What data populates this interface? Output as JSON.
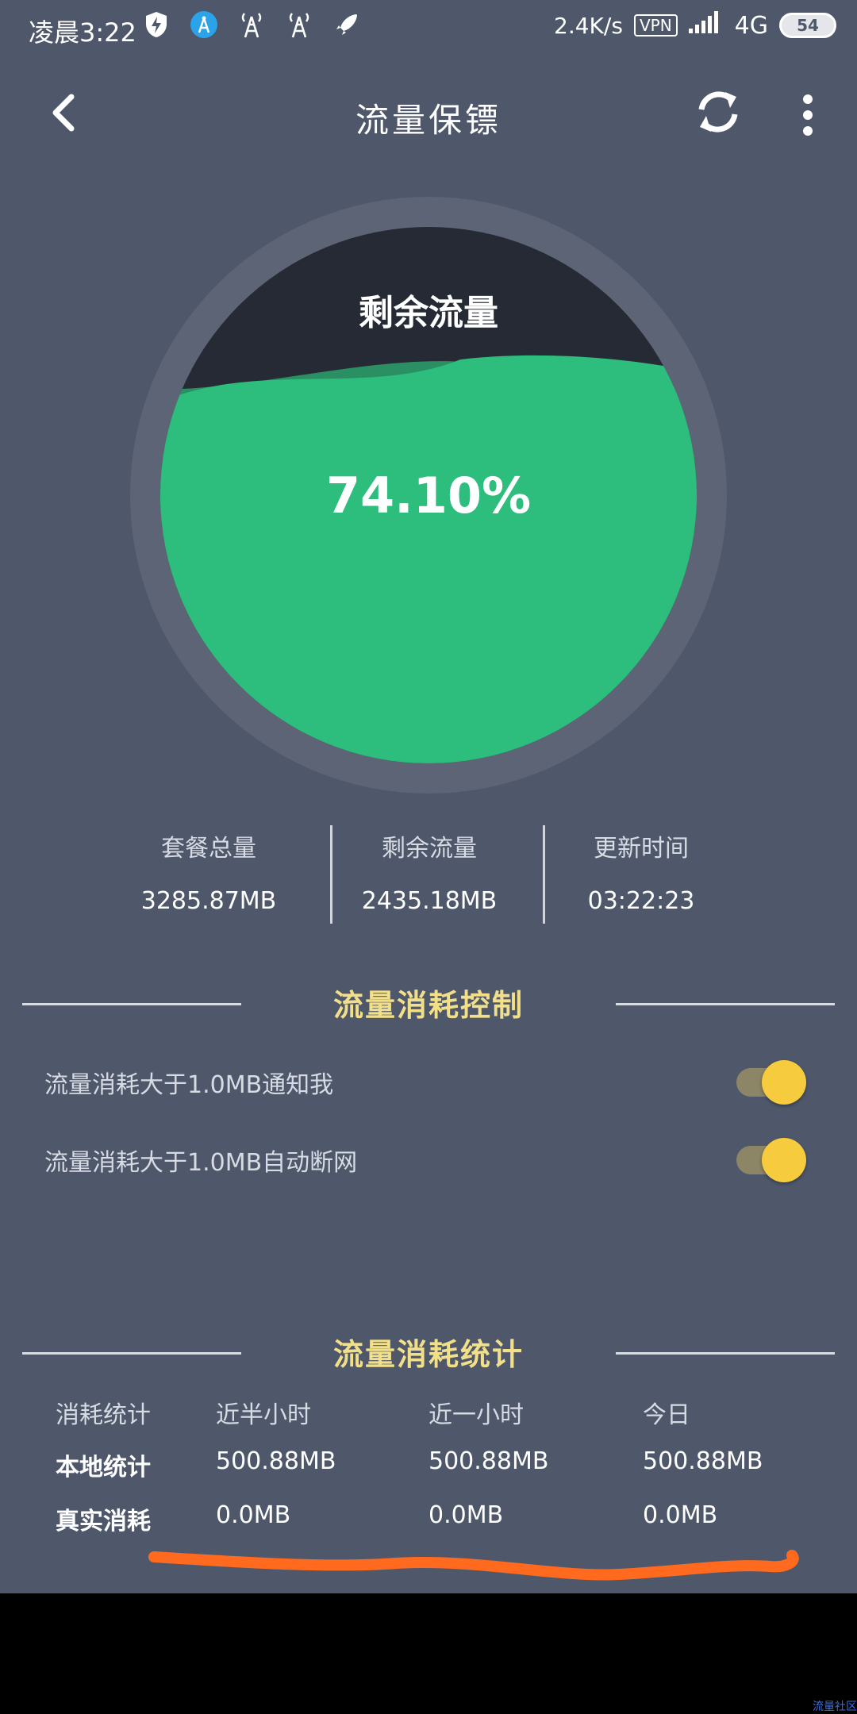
{
  "status_bar": {
    "time": "凌晨3:22",
    "speed": "2.4K/s",
    "vpn": "VPN",
    "network": "4G",
    "battery": "54",
    "icons": [
      "shield-bolt-icon",
      "signal-tower-blue-icon",
      "signal-tower-icon",
      "signal-tower-icon",
      "rocket-icon"
    ]
  },
  "toolbar": {
    "title": "流量保镖",
    "back_icon": "chevron-left-icon",
    "refresh_icon": "refresh-icon",
    "more_icon": "more-vertical-icon"
  },
  "gauge": {
    "label": "剩余流量",
    "percent_text": "74.10%",
    "fill_fraction": 0.741,
    "colors": {
      "ring": "#5c6475",
      "empty": "#262a35",
      "fill": "#2dbd7d",
      "fill_dark": "#2a8f63"
    }
  },
  "stats": [
    {
      "label": "套餐总量",
      "value": "3285.87MB"
    },
    {
      "label": "剩余流量",
      "value": "2435.18MB"
    },
    {
      "label": "更新时间",
      "value": "03:22:23"
    }
  ],
  "control": {
    "title": "流量消耗控制",
    "rows": [
      {
        "label": "流量消耗大于1.0MB通知我",
        "on": true
      },
      {
        "label": "流量消耗大于1.0MB自动断网",
        "on": true
      }
    ]
  },
  "statistics": {
    "title": "流量消耗统计",
    "headers": [
      "消耗统计",
      "近半小时",
      "近一小时",
      "今日"
    ],
    "rows": [
      {
        "label": "本地统计",
        "values": [
          "500.88MB",
          "500.88MB",
          "500.88MB"
        ]
      },
      {
        "label": "真实消耗",
        "values": [
          "0.0MB",
          "0.0MB",
          "0.0MB"
        ]
      }
    ]
  },
  "colors": {
    "background": "#4f586b",
    "accent_yellow": "#f6cb3e",
    "section_title": "#f2df8a",
    "annotation": "#ff6a1f"
  },
  "watermark": "流量社区"
}
